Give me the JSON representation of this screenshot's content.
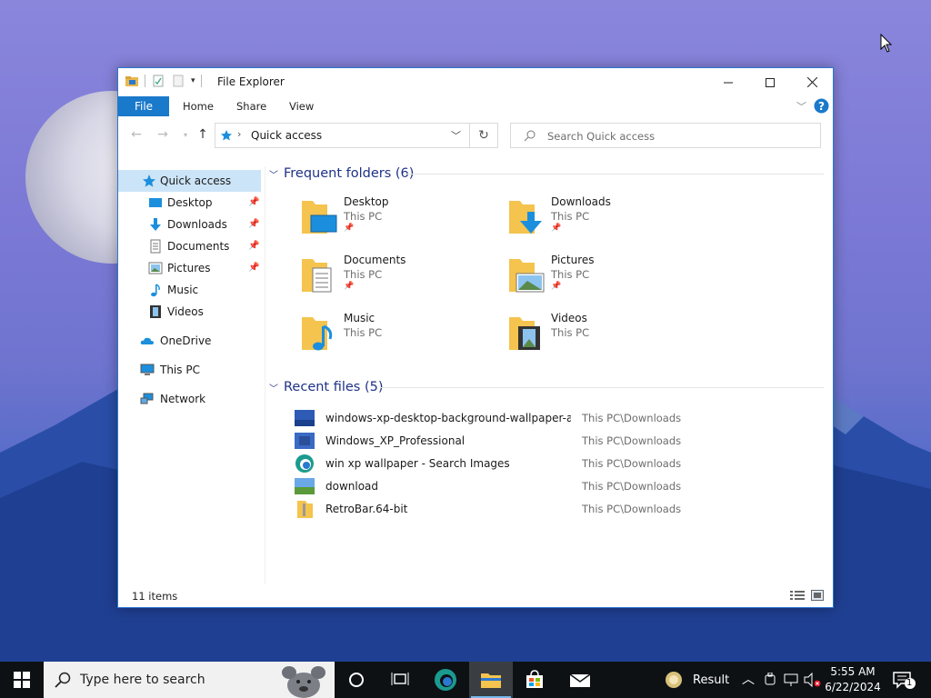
{
  "window": {
    "title": "File Explorer",
    "tabs": {
      "file": "File",
      "home": "Home",
      "share": "Share",
      "view": "View"
    },
    "address": "Quick access",
    "search_placeholder": "Search Quick access",
    "status": "11 items"
  },
  "nav": {
    "items": [
      {
        "label": "Quick access",
        "icon": "star-icon",
        "pinned": false
      },
      {
        "label": "Desktop",
        "icon": "desktop-icon",
        "pinned": true
      },
      {
        "label": "Downloads",
        "icon": "download-icon",
        "pinned": true
      },
      {
        "label": "Documents",
        "icon": "document-icon",
        "pinned": true
      },
      {
        "label": "Pictures",
        "icon": "picture-icon",
        "pinned": true
      },
      {
        "label": "Music",
        "icon": "music-icon",
        "pinned": false
      },
      {
        "label": "Videos",
        "icon": "video-icon",
        "pinned": false
      },
      {
        "label": "OneDrive",
        "icon": "cloud-icon",
        "pinned": false
      },
      {
        "label": "This PC",
        "icon": "computer-icon",
        "pinned": false
      },
      {
        "label": "Network",
        "icon": "network-icon",
        "pinned": false
      }
    ]
  },
  "frequent": {
    "header": "Frequent folders (6)",
    "folders": [
      {
        "name": "Desktop",
        "location": "This PC",
        "pinned": true
      },
      {
        "name": "Downloads",
        "location": "This PC",
        "pinned": true
      },
      {
        "name": "Documents",
        "location": "This PC",
        "pinned": true
      },
      {
        "name": "Pictures",
        "location": "This PC",
        "pinned": true
      },
      {
        "name": "Music",
        "location": "This PC",
        "pinned": false
      },
      {
        "name": "Videos",
        "location": "This PC",
        "pinned": false
      }
    ]
  },
  "recent": {
    "header": "Recent files (5)",
    "files": [
      {
        "name": "windows-xp-desktop-background-wallpaper-asc...",
        "path": "This PC\\Downloads",
        "icon": "image-file-icon"
      },
      {
        "name": "Windows_XP_Professional",
        "path": "This PC\\Downloads",
        "icon": "image-file-icon"
      },
      {
        "name": "win xp wallpaper - Search Images",
        "path": "This PC\\Downloads",
        "icon": "edge-icon"
      },
      {
        "name": "download",
        "path": "This PC\\Downloads",
        "icon": "image-file-icon"
      },
      {
        "name": "RetroBar.64-bit",
        "path": "This PC\\Downloads",
        "icon": "zip-folder-icon"
      }
    ]
  },
  "taskbar": {
    "search_placeholder": "Type here to search",
    "result_label": "Result",
    "time": "5:55 AM",
    "date": "6/22/2024",
    "notification_count": "1"
  }
}
